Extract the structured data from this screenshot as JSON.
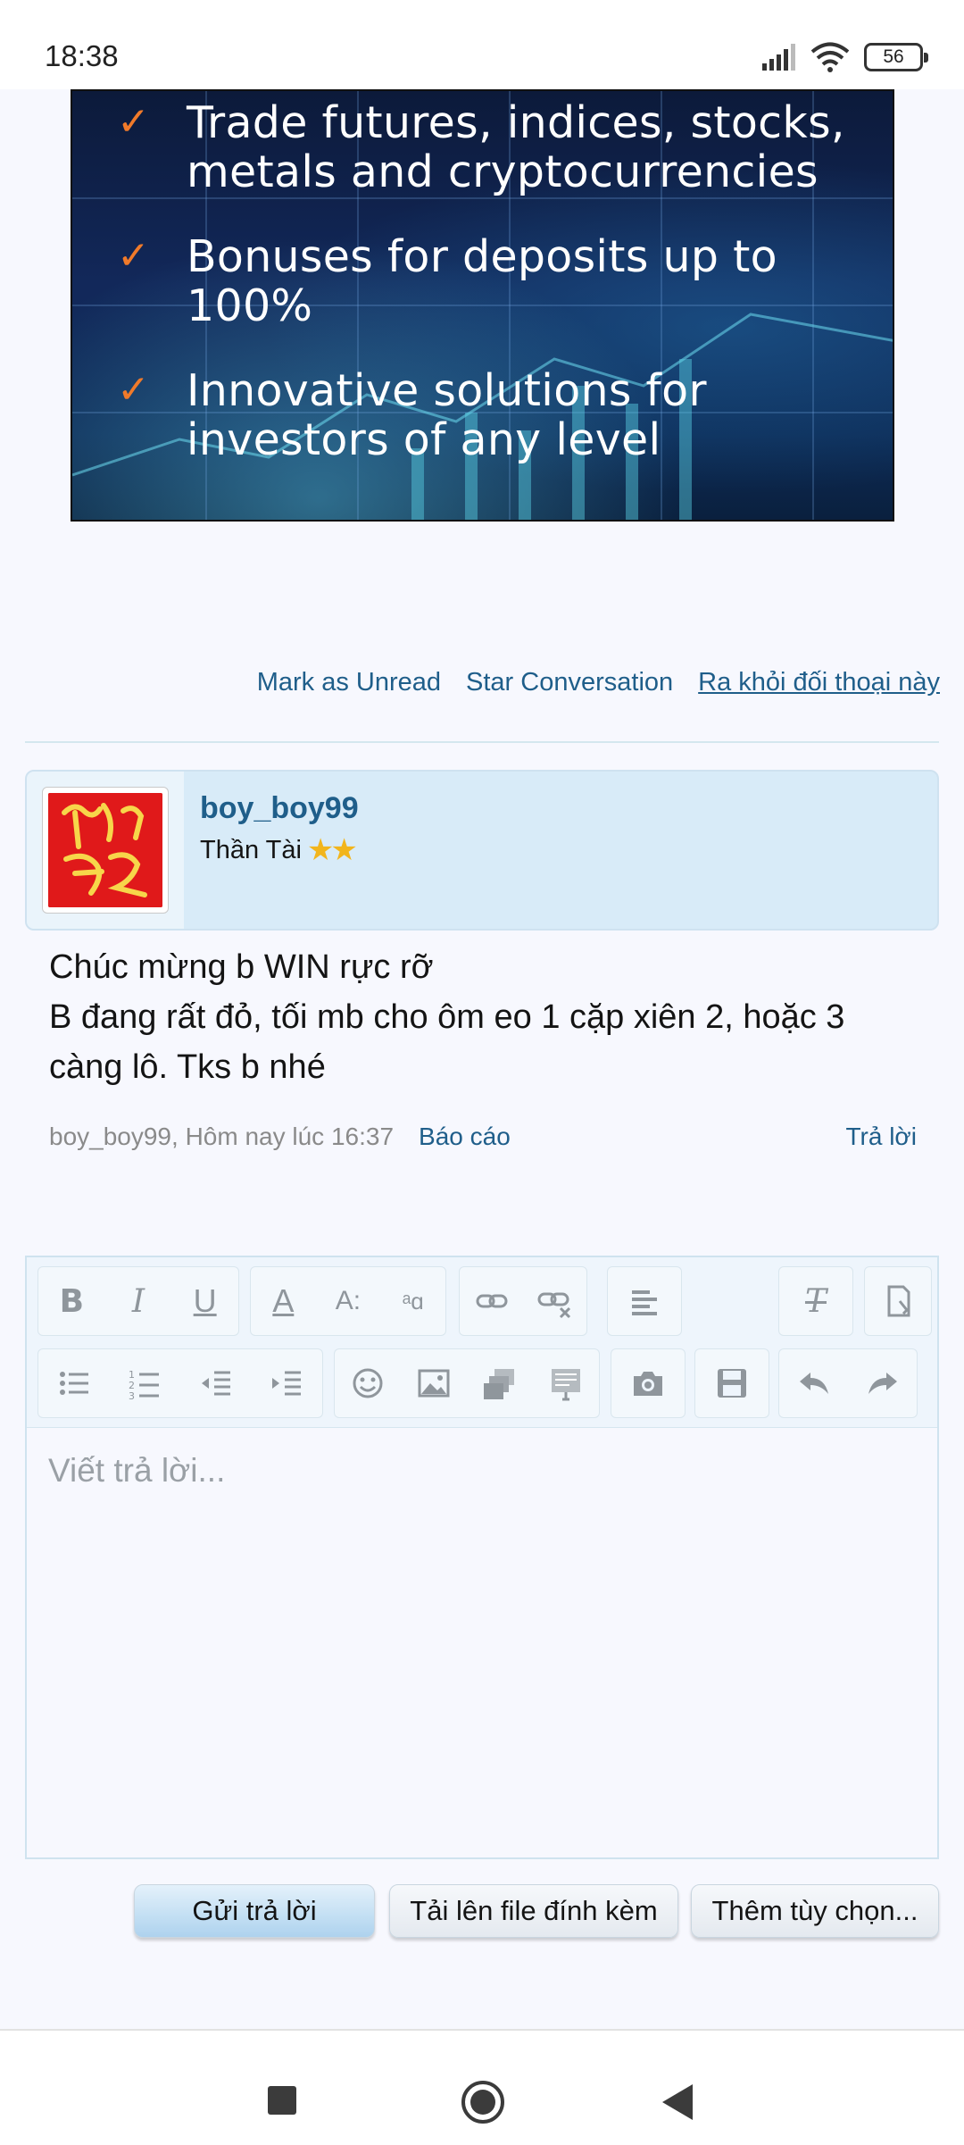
{
  "status_bar": {
    "time": "18:38",
    "battery": "56"
  },
  "ad": {
    "items": [
      "Trade futures, indices, stocks, metals and cryptocurrencies",
      "Bonuses for deposits up to 100%",
      "Innovative solutions for investors of any level"
    ]
  },
  "conversation_actions": {
    "mark_unread": "Mark as Unread",
    "star": "Star Conversation",
    "leave": "Ra khỏi đối thoại này"
  },
  "message": {
    "username": "boy_boy99",
    "user_title": "Thần Tài",
    "rating_stars": 2,
    "body_line1": "Chúc mừng b WIN rực rỡ",
    "body_line2": "B đang rất đỏ, tối mb cho ôm eo 1 cặp xiên 2, hoặc 3 càng lô. Tks b nhé",
    "meta": "boy_boy99, Hôm nay lúc 16:37",
    "report": "Báo cáo",
    "reply": "Trả lời"
  },
  "editor": {
    "placeholder": "Viết trả lời...",
    "toolbar_row1": [
      "bold-icon",
      "italic-icon",
      "underline-icon",
      "font-color-icon",
      "font-size-icon",
      "font-family-icon",
      "link-icon",
      "unlink-icon",
      "align-icon",
      "remove-format-icon",
      "bbcode-toggle-icon"
    ],
    "toolbar_row2": [
      "bullet-list-icon",
      "numbered-list-icon",
      "outdent-icon",
      "indent-icon",
      "smilie-icon",
      "image-icon",
      "media-icon",
      "insert-template-icon",
      "camera-icon",
      "save-draft-icon",
      "undo-icon",
      "redo-icon"
    ]
  },
  "buttons": {
    "submit": "Gửi trả lời",
    "upload": "Tải lên file đính kèm",
    "more": "Thêm tùy chọn..."
  },
  "colors": {
    "link": "#1f5e8a",
    "card_bg": "#d8ebf8",
    "ad_check": "#f07a2a"
  }
}
